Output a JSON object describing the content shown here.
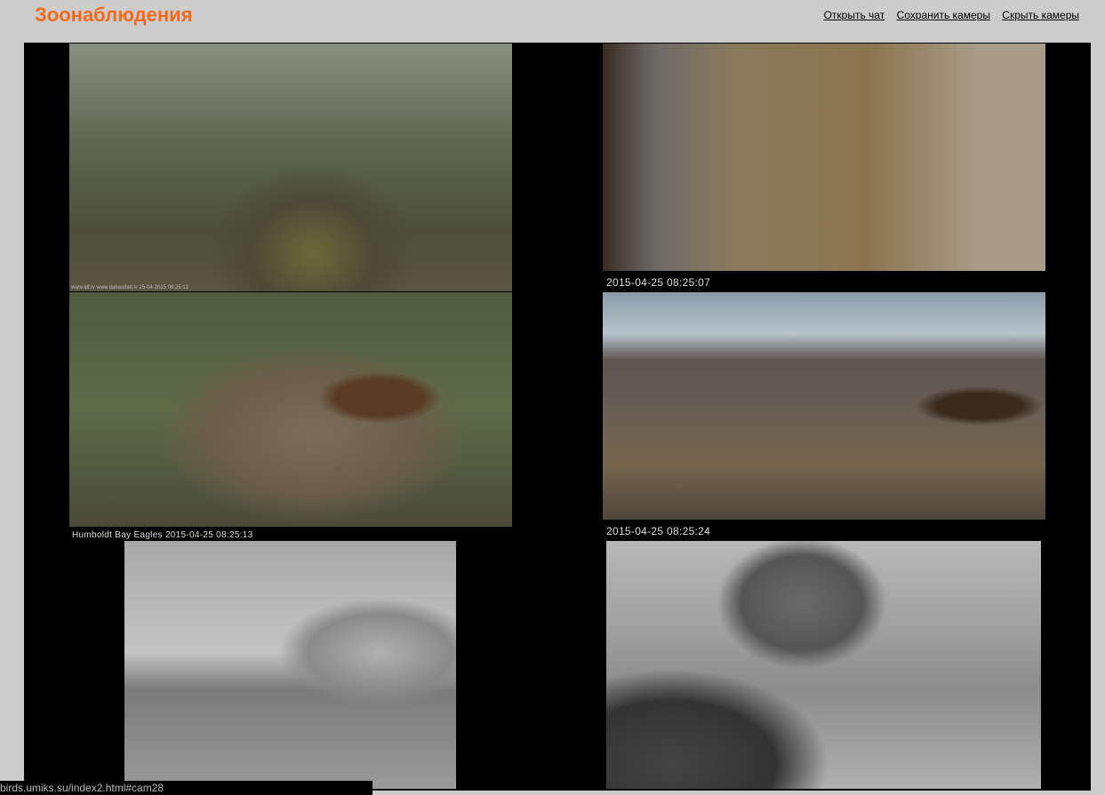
{
  "header": {
    "title": "Зоонаблюдения",
    "links": [
      "Открыть чат",
      "Сохранить камеры",
      "Скрыть камеры"
    ]
  },
  "cameras": [
    {
      "overlay": "www.ldf.lv www.dabasdati.lv 25-04-2015 08:25:12",
      "caption": ""
    },
    {
      "caption": "2015-04-25 08:25:07"
    },
    {
      "caption": "Humboldt Bay Eagles 2015-04-25 08:25:13"
    },
    {
      "caption": "2015-04-25 08:25:24"
    },
    {
      "caption": ""
    },
    {
      "caption": ""
    }
  ],
  "status_bar": {
    "url": "birds.umiks.su/index2.html#cam28"
  }
}
